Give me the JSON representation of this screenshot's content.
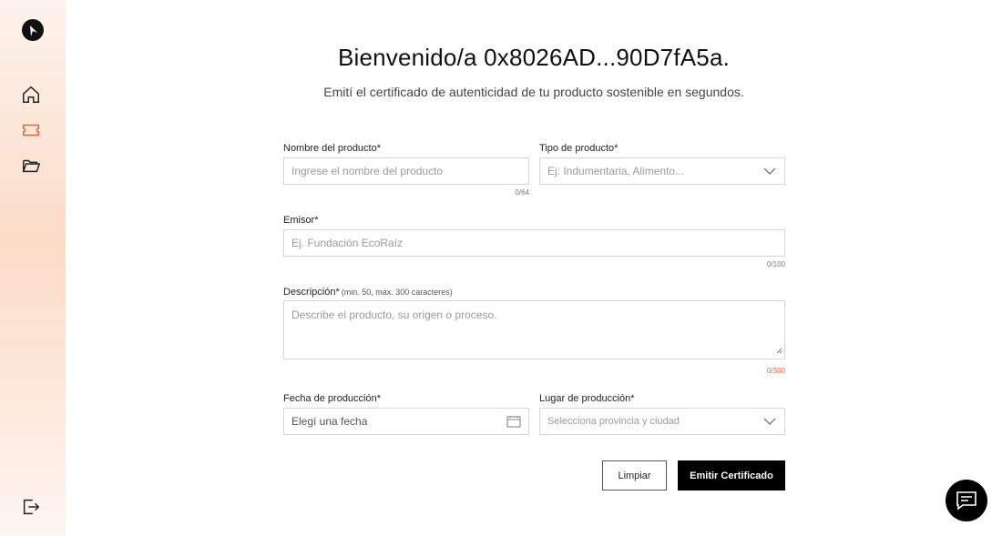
{
  "sidebar": {
    "items": [
      {
        "name": "home",
        "icon": "home-icon"
      },
      {
        "name": "tickets",
        "icon": "ticket-icon"
      },
      {
        "name": "folder",
        "icon": "folder-icon"
      }
    ],
    "logout_icon": "logout-icon",
    "accent_color": "#e0643c"
  },
  "header": {
    "title": "Bienvenido/a 0x8026AD...90D7fA5a.",
    "subtitle": "Emití el certificado de autenticidad de tu producto sostenible en segundos."
  },
  "form": {
    "product_name": {
      "label": "Nombre del producto*",
      "placeholder": "Ingrese el nombre del producto",
      "counter": "0/64"
    },
    "product_type": {
      "label": "Tipo de producto*",
      "placeholder": "Ej: Indumentaria, Alimento..."
    },
    "issuer": {
      "label": "Emisor*",
      "placeholder": "Ej. Fundación EcoRaíz",
      "counter": "0/100"
    },
    "description": {
      "label": "Descripción*",
      "hint": "(min. 50, máx. 300 caracteres)",
      "placeholder": "Describe el producto, su origen o proceso.",
      "counter": "0/300"
    },
    "production_date": {
      "label": "Fecha de producción*",
      "placeholder": "Elegí una fecha"
    },
    "production_place": {
      "label": "Lugar de producción*",
      "placeholder": "Selecciona provincia y ciudad"
    }
  },
  "actions": {
    "clear_label": "Limpiar",
    "emit_label": "Emitir Certificado"
  },
  "chat": {
    "icon": "chat-icon"
  }
}
